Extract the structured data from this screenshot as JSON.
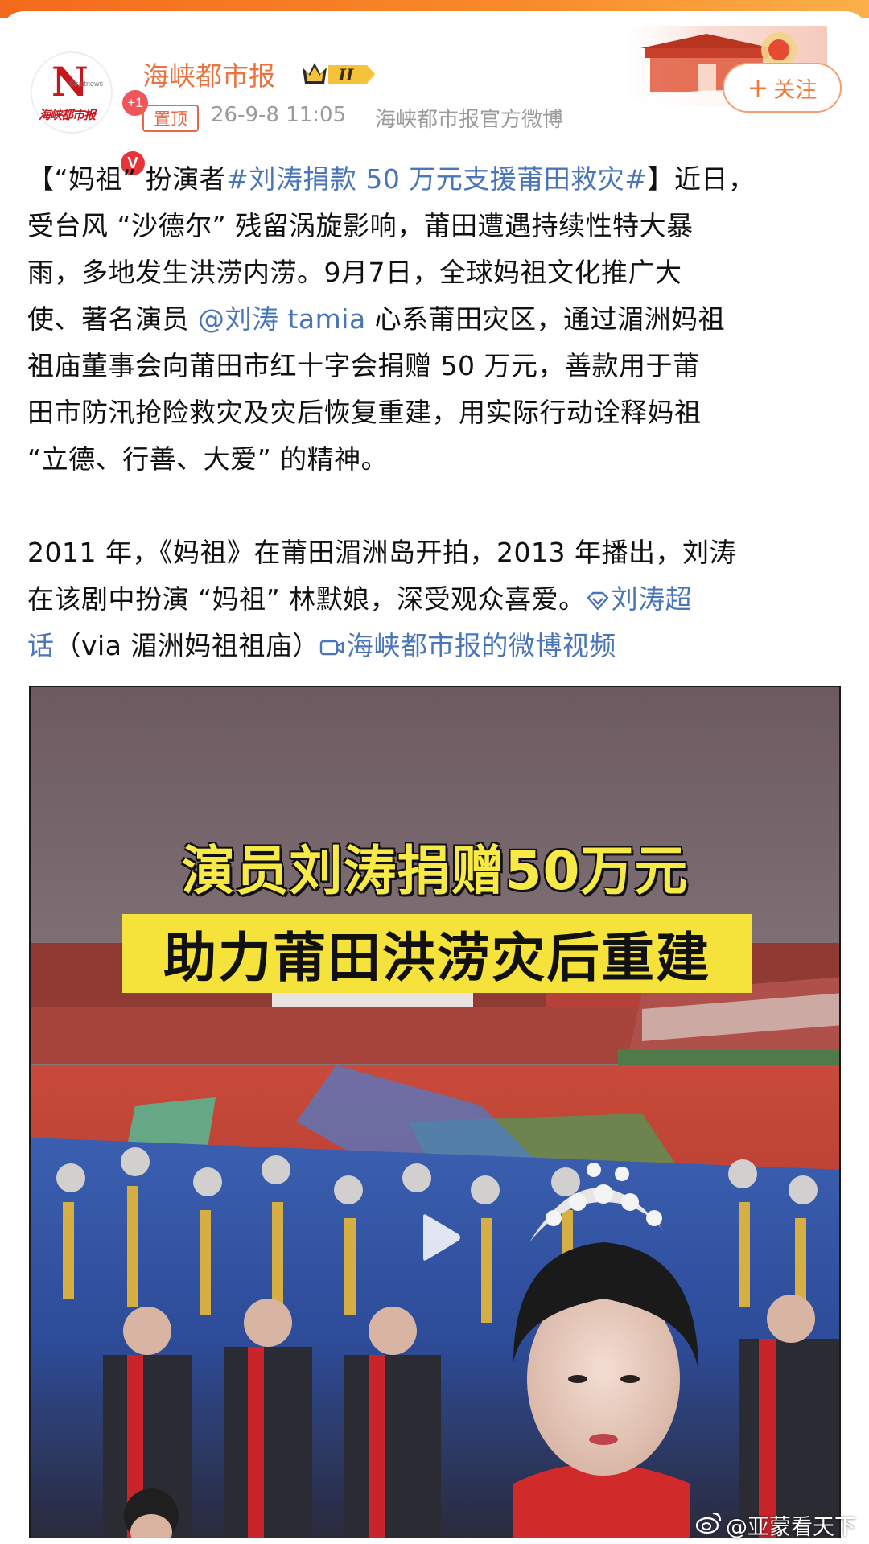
{
  "header": {
    "avatar": {
      "letter": "N",
      "sub_text": "Straitnews",
      "calligraphy": "海峡都市报",
      "badge_count": "+1",
      "verified_mark": "V"
    },
    "account_name": "海峡都市报",
    "vip_level": "II",
    "pin_tag": "置顶",
    "time": "26-9-8 11:05",
    "source": "海峡都市报官方微博",
    "follow_button": {
      "icon": "plus-icon",
      "label": "关注"
    }
  },
  "post": {
    "p1": {
      "l1_a": "【“妈祖” 扮演者",
      "l1_tag": "#刘涛捐款 50 万元支援莆田救灾#",
      "l1_b": "】近日，",
      "l2": "受台风 “沙德尔” 残留涡旋影响，莆田遭遇持续性特大暴",
      "l3": "雨，多地发生洪涝内涝。9月7日，全球妈祖文化推广大",
      "l4_a": "使、著名演员 ",
      "l4_mention": "@刘涛 tamia",
      "l4_b": " 心系莆田灾区，通过湄洲妈祖",
      "l5": "祖庙董事会向莆田市红十字会捐赠 50 万元，善款用于莆",
      "l6": "田市防汛抢险救灾及灾后恢复重建，用实际行动诠释妈祖",
      "l7": "“立德、行善、大爱” 的精神。"
    },
    "p2": {
      "l1": "2011 年，《妈祖》在莆田湄洲岛开拍，2013 年播出，刘涛",
      "l2_a": "在该剧中扮演 “妈祖” 林默娘，深受观众喜爱。",
      "l2_topic": "刘涛超",
      "l3_topic": "话",
      "l3_b": "（via 湄洲妈祖祖庙）",
      "l3_video_link": "海峡都市报的微博视频"
    }
  },
  "video": {
    "headline_1": "演员刘涛捐赠50万元",
    "headline_2": "助力莆田洪涝灾后重建",
    "play_icon": "play-icon"
  },
  "watermark": "@亚蒙看天下",
  "colors": {
    "accent_orange": "#eb7340",
    "link_blue": "#4a76b8",
    "headline_yellow": "#f5e33b",
    "text": "#111111",
    "meta_gray": "#9b9b9b"
  }
}
